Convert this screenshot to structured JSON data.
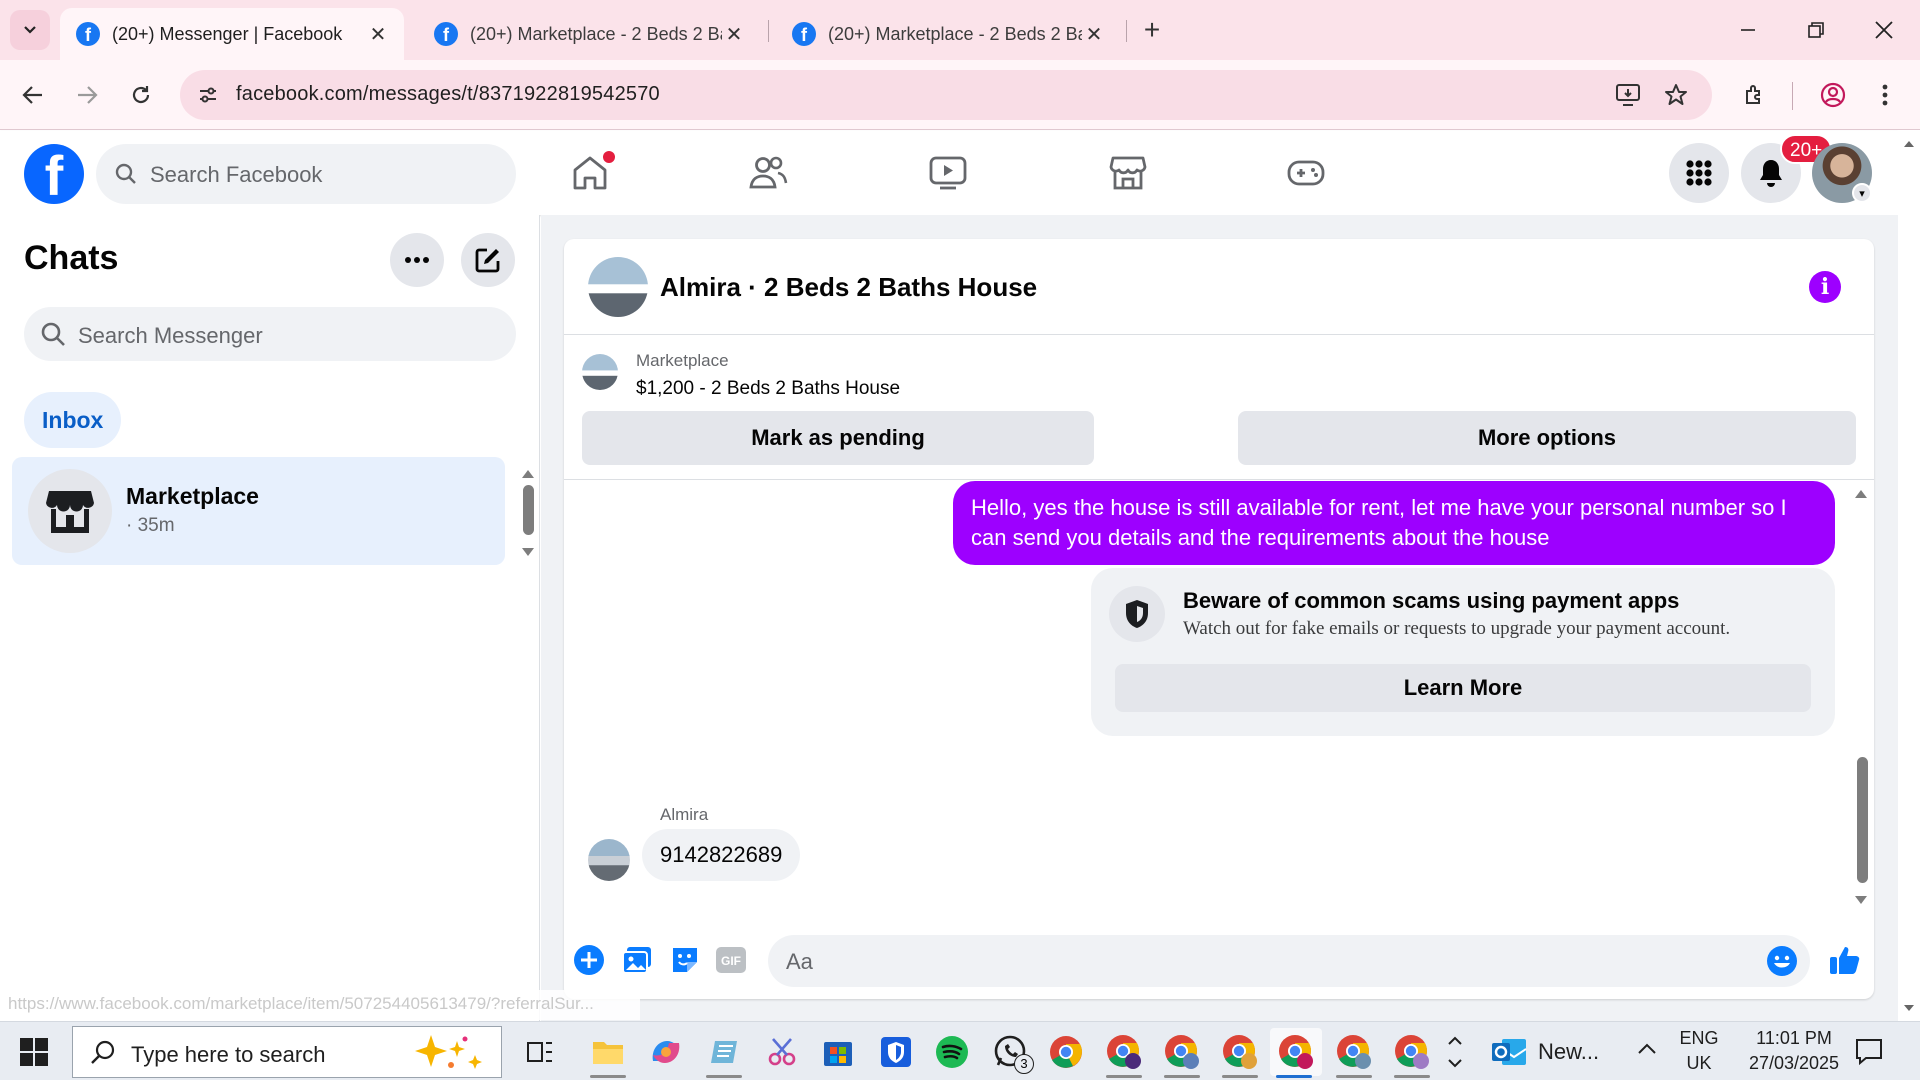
{
  "browser": {
    "tabs": [
      {
        "title": "(20+) Messenger | Facebook",
        "active": true
      },
      {
        "title": "(20+) Marketplace - 2 Beds 2 Ba",
        "active": false
      },
      {
        "title": "(20+) Marketplace - 2 Beds 2 Ba",
        "active": false
      }
    ],
    "url": "facebook.com/messages/t/8371922819542570",
    "status_url": "https://www.facebook.com/marketplace/item/507254405613479/?referralSur..."
  },
  "facebook": {
    "search_placeholder": "Search Facebook",
    "notification_badge": "20+",
    "nav_icons": [
      "home-icon",
      "friends-icon",
      "video-icon",
      "marketplace-icon",
      "gaming-icon"
    ]
  },
  "chats": {
    "title": "Chats",
    "search_placeholder": "Search Messenger",
    "filter": "Inbox",
    "items": [
      {
        "name": "Marketplace",
        "time": "· 35m"
      }
    ]
  },
  "conversation": {
    "title": "Almira · 2 Beds 2 Baths House",
    "marketplace_label": "Marketplace",
    "listing": "$1,200 - 2 Beds 2 Baths House",
    "mark_pending": "Mark as pending",
    "more_options": "More options",
    "outgoing_message": "Hello, yes the house is still available for rent, let me have your personal number so I can send you details and the requirements about the house",
    "scam_title": "Beware of common scams using payment apps",
    "scam_desc": "Watch out for fake emails or requests to upgrade your payment account.",
    "learn_more": "Learn More",
    "sender_name": "Almira",
    "incoming_message": "9142822689",
    "composer_placeholder": "Aa",
    "accent_color": "#9d00ff"
  },
  "taskbar": {
    "search_placeholder": "Type here to search",
    "whatsapp_badge": "3",
    "outlook_label": "New...",
    "lang_top": "ENG",
    "lang_bottom": "UK",
    "time": "11:01 PM",
    "date": "27/03/2025"
  }
}
